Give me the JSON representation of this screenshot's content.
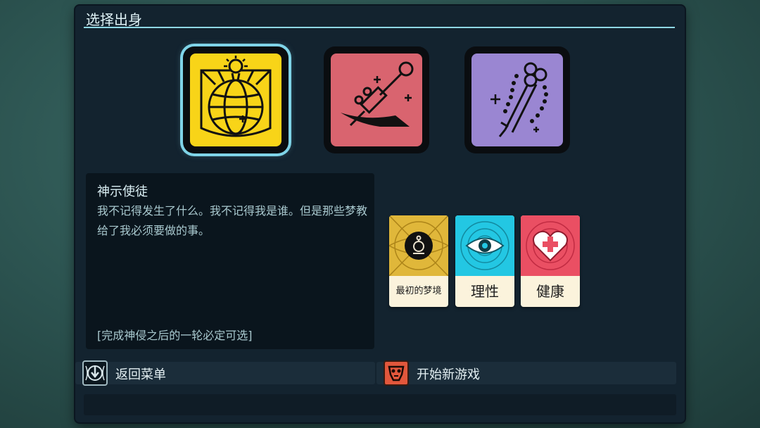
{
  "panel": {
    "title": "选择出身"
  },
  "origins": [
    {
      "icon": "sunburst-globe-icon",
      "color": "#f8d418",
      "selected": true
    },
    {
      "icon": "syringe-knife-icon",
      "color": "#d9646f",
      "selected": false
    },
    {
      "icon": "key-rosary-icon",
      "color": "#9a86d2",
      "selected": false
    }
  ],
  "description": {
    "title": "神示使徒",
    "text": "我不记得发生了什么。我不记得我是谁。但是那些梦教给了我必须要做的事。",
    "footer": "[完成神侵之后的一轮必定可选]"
  },
  "stats": [
    {
      "label": "最初的梦境",
      "icon": "lantern-icon",
      "color": "#e0b73a"
    },
    {
      "label": "理性",
      "icon": "eye-icon",
      "color": "#23c7e3"
    },
    {
      "label": "健康",
      "icon": "heart-icon",
      "color": "#ea4f63"
    }
  ],
  "actions": {
    "back_menu": "返回菜单",
    "new_game": "开始新游戏"
  }
}
